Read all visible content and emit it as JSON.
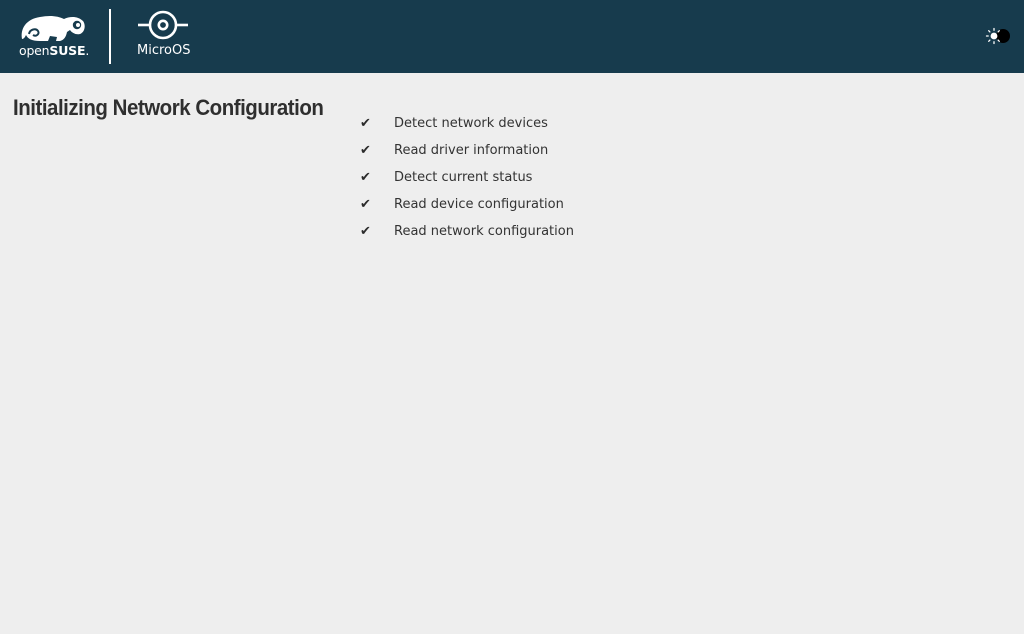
{
  "header": {
    "brand": {
      "prefix": "open",
      "suffix": "SUSE",
      "mark": "."
    },
    "product": "MicroOS",
    "theme_toggle_icon": "sun-moon-toggle-icon"
  },
  "main": {
    "title": "Initializing Network Configuration",
    "steps": [
      {
        "label": "Detect network devices",
        "status": "done",
        "icon": "check-icon"
      },
      {
        "label": "Read driver information",
        "status": "done",
        "icon": "check-icon"
      },
      {
        "label": "Detect current status",
        "status": "done",
        "icon": "check-icon"
      },
      {
        "label": "Read device configuration",
        "status": "done",
        "icon": "check-icon"
      },
      {
        "label": "Read network configuration",
        "status": "done",
        "icon": "check-icon"
      }
    ]
  },
  "colors": {
    "header_bg": "#173b4d",
    "page_bg": "#eeeeee",
    "text": "#2b2b2b"
  }
}
